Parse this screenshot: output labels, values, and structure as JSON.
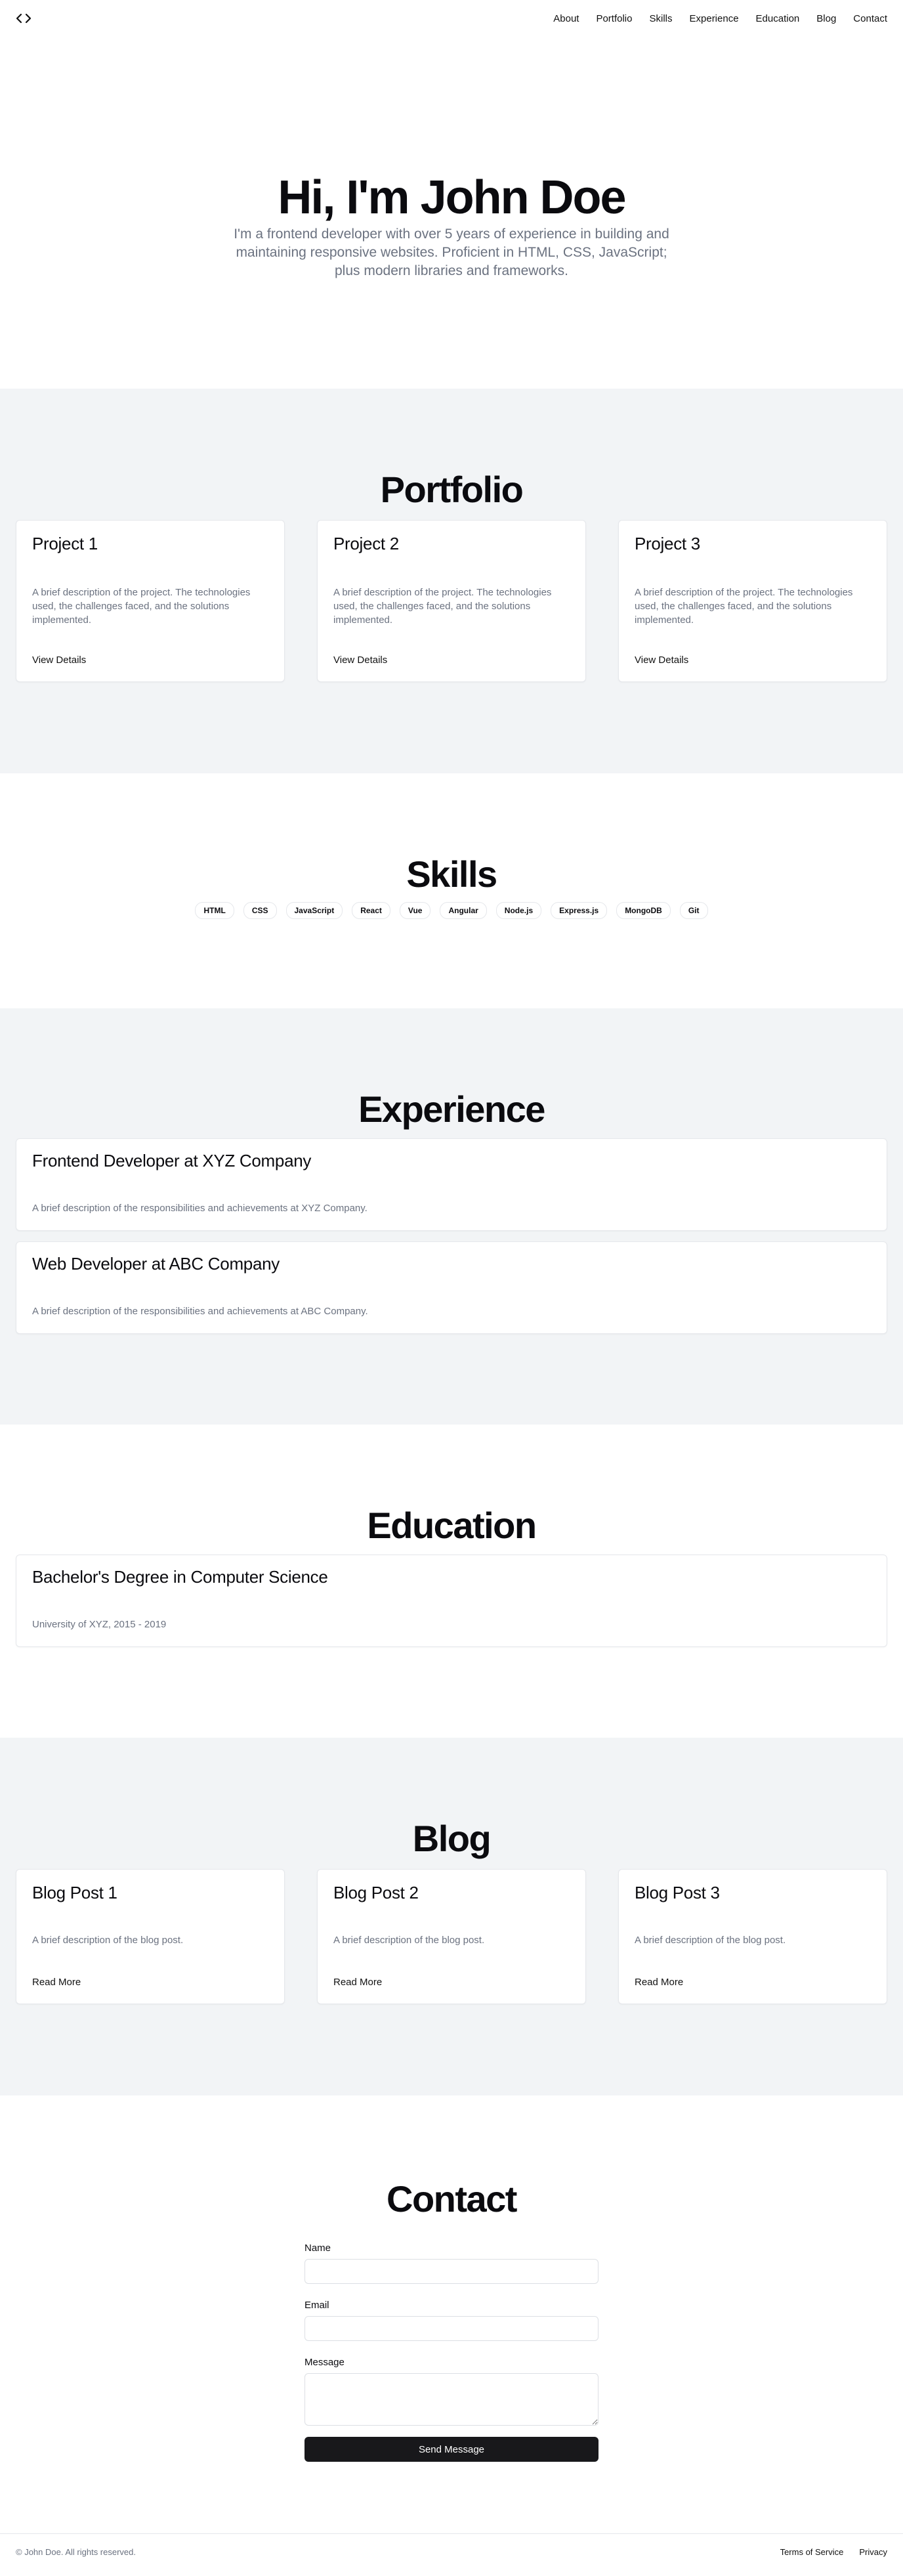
{
  "nav": {
    "logo_icon": "code-brackets-icon",
    "links": [
      "About",
      "Portfolio",
      "Skills",
      "Experience",
      "Education",
      "Blog",
      "Contact"
    ]
  },
  "hero": {
    "title": "Hi, I'm John Doe",
    "subtitle": "I'm a frontend developer with over 5 years of experience in building and maintaining responsive websites. Proficient in HTML, CSS, JavaScript; plus modern libraries and frameworks."
  },
  "portfolio": {
    "title": "Portfolio",
    "projects": [
      {
        "title": "Project 1",
        "description": "A brief description of the project. The technologies used, the challenges faced, and the solutions implemented.",
        "link": "View Details"
      },
      {
        "title": "Project 2",
        "description": "A brief description of the project. The technologies used, the challenges faced, and the solutions implemented.",
        "link": "View Details"
      },
      {
        "title": "Project 3",
        "description": "A brief description of the project. The technologies used, the challenges faced, and the solutions implemented.",
        "link": "View Details"
      }
    ]
  },
  "skills": {
    "title": "Skills",
    "items": [
      "HTML",
      "CSS",
      "JavaScript",
      "React",
      "Vue",
      "Angular",
      "Node.js",
      "Express.js",
      "MongoDB",
      "Git"
    ]
  },
  "experience": {
    "title": "Experience",
    "items": [
      {
        "title": "Frontend Developer at XYZ Company",
        "description": "A brief description of the responsibilities and achievements at XYZ Company."
      },
      {
        "title": "Web Developer at ABC Company",
        "description": "A brief description of the responsibilities and achievements at ABC Company."
      }
    ]
  },
  "education": {
    "title": "Education",
    "items": [
      {
        "title": "Bachelor's Degree in Computer Science",
        "description": "University of XYZ, 2015 - 2019"
      }
    ]
  },
  "blog": {
    "title": "Blog",
    "posts": [
      {
        "title": "Blog Post 1",
        "description": "A brief description of the blog post.",
        "link": "Read More"
      },
      {
        "title": "Blog Post 2",
        "description": "A brief description of the blog post.",
        "link": "Read More"
      },
      {
        "title": "Blog Post 3",
        "description": "A brief description of the blog post.",
        "link": "Read More"
      }
    ]
  },
  "contact": {
    "title": "Contact",
    "name_label": "Name",
    "email_label": "Email",
    "message_label": "Message",
    "submit_label": "Send Message"
  },
  "footer": {
    "copyright": "© John Doe. All rights reserved.",
    "links": [
      "Terms of Service",
      "Privacy"
    ]
  }
}
